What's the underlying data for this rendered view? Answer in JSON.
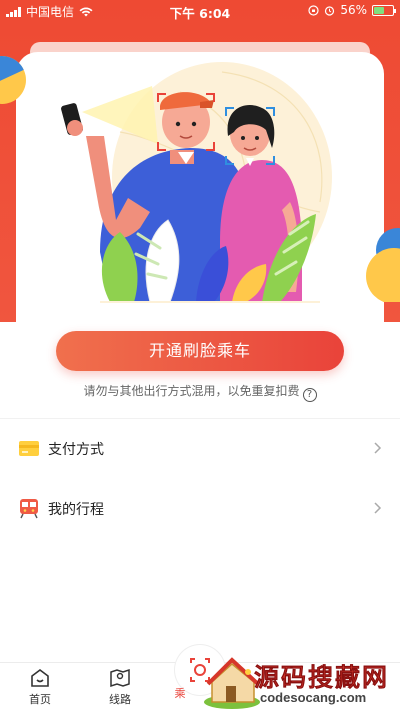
{
  "status_bar": {
    "carrier": "中国电信",
    "time": "下午 6:04",
    "battery_percent": "56%",
    "battery_level": 0.56
  },
  "hero": {
    "illustration": "face-scan-couple-illustration",
    "cta_label": "开通刷脸乘车",
    "notice": "请勿与其他出行方式混用，以免重复扣费",
    "help_glyph": "?"
  },
  "menu": [
    {
      "label": "支付方式",
      "icon": "card-icon"
    },
    {
      "label": "我的行程",
      "icon": "train-icon"
    }
  ],
  "tabbar": {
    "tabs": [
      {
        "label": "首页",
        "icon": "home-icon",
        "active": false
      },
      {
        "label": "线路",
        "icon": "map-icon",
        "active": false
      },
      {
        "label": "乘",
        "icon": "face-scan-icon",
        "active": true
      }
    ]
  },
  "watermark": {
    "title": "源码搜藏网",
    "subtitle": "codesocang.com"
  },
  "colors": {
    "brand_red": "#ee4a33",
    "button_gradient_start": "#f0704d",
    "button_gradient_end": "#e9433a",
    "text_primary": "#222222",
    "text_secondary": "#666666"
  }
}
